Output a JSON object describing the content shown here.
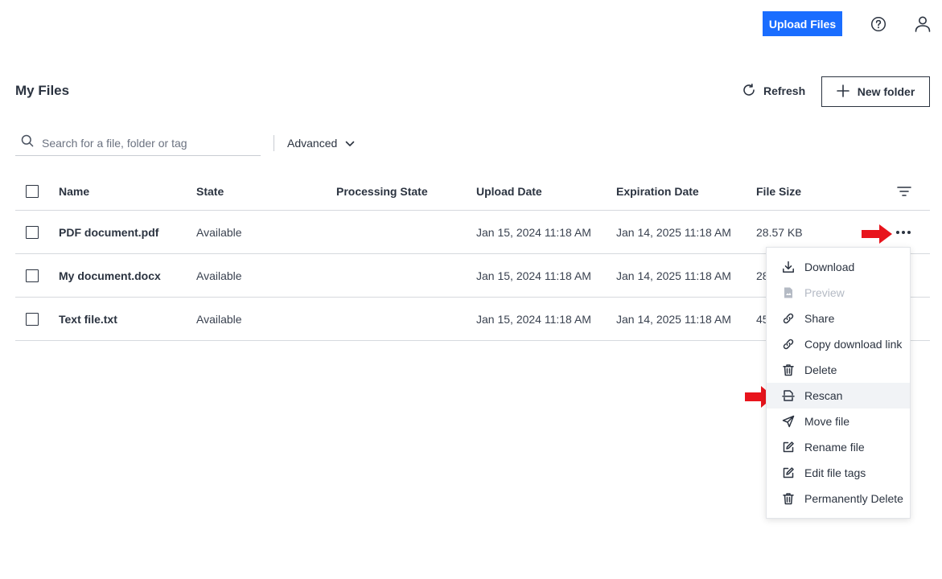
{
  "topbar": {
    "upload_label": "Upload Files",
    "help_icon": "help-circle-icon",
    "user_icon": "user-icon"
  },
  "header": {
    "title": "My Files",
    "refresh_label": "Refresh",
    "new_folder_label": "New folder"
  },
  "search": {
    "placeholder": "Search for a file, folder or tag",
    "value": "",
    "advanced_label": "Advanced"
  },
  "table": {
    "columns": [
      "Name",
      "State",
      "Processing State",
      "Upload Date",
      "Expiration Date",
      "File Size"
    ],
    "rows": [
      {
        "name": "PDF document.pdf",
        "state": "Available",
        "processing_state": "",
        "upload_date": "Jan 15, 2024 11:18 AM",
        "expiration_date": "Jan 14, 2025 11:18 AM",
        "file_size": "28.57 KB"
      },
      {
        "name": "My document.docx",
        "state": "Available",
        "processing_state": "",
        "upload_date": "Jan 15, 2024 11:18 AM",
        "expiration_date": "Jan 14, 2025 11:18 AM",
        "file_size": "28"
      },
      {
        "name": "Text file.txt",
        "state": "Available",
        "processing_state": "",
        "upload_date": "Jan 15, 2024 11:18 AM",
        "expiration_date": "Jan 14, 2025 11:18 AM",
        "file_size": "45"
      }
    ]
  },
  "context_menu": {
    "items": [
      {
        "label": "Download",
        "icon": "download-icon",
        "disabled": false
      },
      {
        "label": "Preview",
        "icon": "file-preview-icon",
        "disabled": true
      },
      {
        "label": "Share",
        "icon": "link-icon",
        "disabled": false
      },
      {
        "label": "Copy download link",
        "icon": "link-icon",
        "disabled": false
      },
      {
        "label": "Delete",
        "icon": "trash-icon",
        "disabled": false
      },
      {
        "label": "Rescan",
        "icon": "scan-icon",
        "disabled": false,
        "highlighted": true
      },
      {
        "label": "Move file",
        "icon": "send-icon",
        "disabled": false
      },
      {
        "label": "Rename file",
        "icon": "edit-icon",
        "disabled": false
      },
      {
        "label": "Edit file tags",
        "icon": "edit-icon",
        "disabled": false
      },
      {
        "label": "Permanently Delete",
        "icon": "trash-icon",
        "disabled": false
      }
    ]
  },
  "colors": {
    "primary": "#1a6dff",
    "text": "#2b3340",
    "annotation_arrow": "#e8141c",
    "disabled_text": "#b4bac4"
  }
}
